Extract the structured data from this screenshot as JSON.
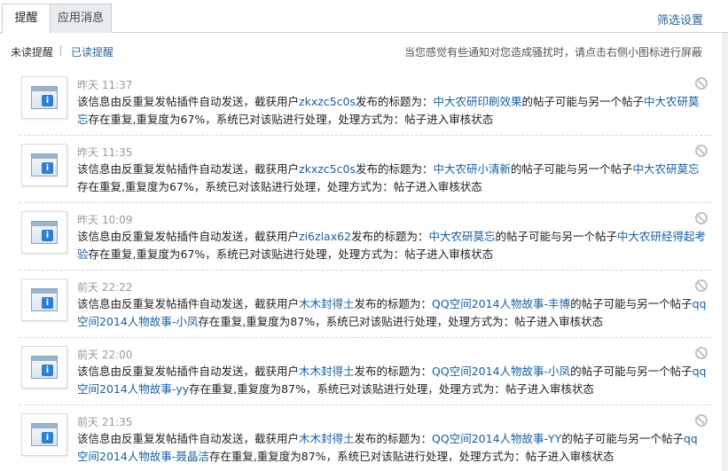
{
  "tabs": {
    "remind": "提醒",
    "app_message": "应用消息"
  },
  "filter_settings": "筛选设置",
  "sub": {
    "unread": "未读提醒",
    "read": "已读提醒",
    "hint": "当您感觉有些通知对您造成骚扰时，请点击右侧小图标进行屏蔽"
  },
  "items": [
    {
      "time": "昨天 11:37",
      "p1": "该信息由反重复发帖插件自动发送，截获用户",
      "user": "zkxzc5c0s",
      "p2": "发布的标题为：",
      "post1": "中大农研印刷效果",
      "p3": "的帖子可能与另一个帖子",
      "post2": "中大农研莫忘",
      "p4": "存在重复,重复度为67%，系统已对该贴进行处理，处理方式为：帖子进入审核状态"
    },
    {
      "time": "昨天 11:35",
      "p1": "该信息由反重复发帖插件自动发送，截获用户",
      "user": "zkxzc5c0s",
      "p2": "发布的标题为：",
      "post1": "中大农研小清新",
      "p3": "的帖子可能与另一个帖子",
      "post2": "中大农研莫忘",
      "p4": "存在重复,重复度为67%，系统已对该贴进行处理，处理方式为：帖子进入审核状态"
    },
    {
      "time": "昨天 10:09",
      "p1": "该信息由反重复发帖插件自动发送，截获用户",
      "user": "zi6zlax62",
      "p2": "发布的标题为：",
      "post1": "中大农研莫忘",
      "p3": "的帖子可能与另一个帖子",
      "post2": "中大农研经得起考验",
      "p4": "存在重复,重复度为67%，系统已对该贴进行处理，处理方式为：帖子进入审核状态"
    },
    {
      "time": "前天 22:22",
      "p1": "该信息由反重复发帖插件自动发送，截获用户",
      "user": "木木封得土",
      "p2": "发布的标题为：",
      "post1": "QQ空间2014人物故事-丰博",
      "p3": "的帖子可能与另一个帖子",
      "post2": "qq空间2014人物故事-小凤",
      "p4": "存在重复,重复度为87%，系统已对该贴进行处理，处理方式为：帖子进入审核状态"
    },
    {
      "time": "前天 22:00",
      "p1": "该信息由反重复发帖插件自动发送，截获用户",
      "user": "木木封得土",
      "p2": "发布的标题为：",
      "post1": "QQ空间2014人物故事-小凤",
      "p3": "的帖子可能与另一个帖子",
      "post2": "qq空间2014人物故事-yy",
      "p4": "存在重复,重复度为87%，系统已对该贴进行处理，处理方式为：帖子进入审核状态"
    },
    {
      "time": "前天 21:35",
      "p1": "该信息由反重复发帖插件自动发送，截获用户",
      "user": "木木封得土",
      "p2": "发布的标题为：",
      "post1": "QQ空间2014人物故事-YY",
      "p3": "的帖子可能与另一个帖子",
      "post2": "qq空间2014人物故事-聂晶洁",
      "p4": "存在重复,重复度为87%，系统已对该贴进行处理，处理方式为：帖子进入审核状态"
    }
  ]
}
